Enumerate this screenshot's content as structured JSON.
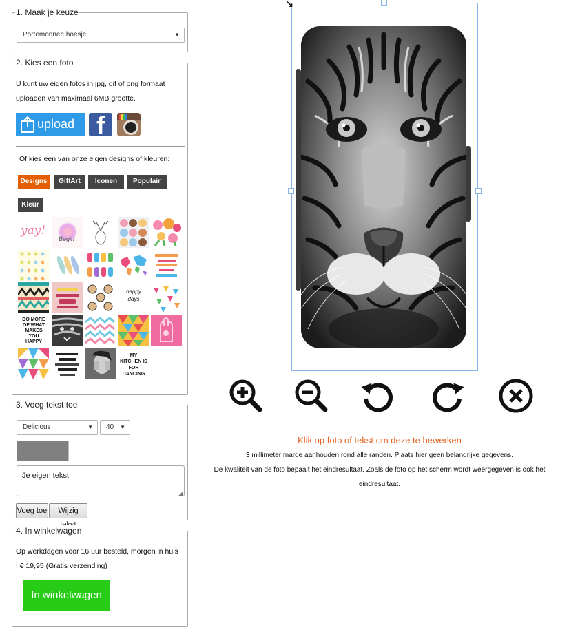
{
  "step1": {
    "legend": "1. Maak je keuze",
    "product_select": "Portemonnee hoesje"
  },
  "step2": {
    "legend": "2. Kies een foto",
    "description_line1": "U kunt uw eigen fotos in jpg, gif of png formaat",
    "description_line2": "uploaden van maximaal 6MB grootte.",
    "upload_label": "upload",
    "designs_intro": "Of kies een van onze eigen designs of kleuren:",
    "tabs": [
      "Designs",
      "GiftArt",
      "Iconen",
      "Populair",
      "Kleur"
    ],
    "thumbs": {
      "yay": "yay!",
      "begin": "Begin",
      "happy": "happy days",
      "do_more": "DO MORE OF WHAT MAKES YOU HAPPY",
      "kitchen": "MY KITCHEN IS FOR DANCING"
    }
  },
  "step3": {
    "legend": "3. Voeg tekst toe",
    "font_select": "Delicious",
    "size_select": "40",
    "text_value": "Je eigen tekst",
    "add_button": "Voeg toe",
    "edit_button": "Wijzig tekst",
    "color_swatch": "#808080"
  },
  "step4": {
    "legend": "4. In winkelwagen",
    "delivery_text": "Op werkdagen voor 16 uur besteld, morgen in huis",
    "price_text": "| € 19,95 (Gratis verzending)",
    "cart_button": "In winkelwagen"
  },
  "editor": {
    "hint": "Klik op foto of tekst om deze te bewerken",
    "margin_note": "3 millimeter marge aanhouden rond alle randen. Plaats hier geen belangrijke gegevens.",
    "quality_note_line1": "De kwaliteit van de foto bepaalt het eindresultaat. Zoals de foto op het scherm wordt weergegeven is ook het",
    "quality_note_line2": "eindresultaat.",
    "tools": [
      "zoom-in-icon",
      "zoom-out-icon",
      "rotate-left-icon",
      "rotate-right-icon",
      "delete-icon"
    ]
  },
  "colors": {
    "accent_orange": "#e35e00",
    "tab_dark": "#444444",
    "upload_blue": "#2f9be8",
    "cart_green": "#27cc17",
    "hint_orange": "#e0611f",
    "selection_blue": "#8ab4e8"
  }
}
